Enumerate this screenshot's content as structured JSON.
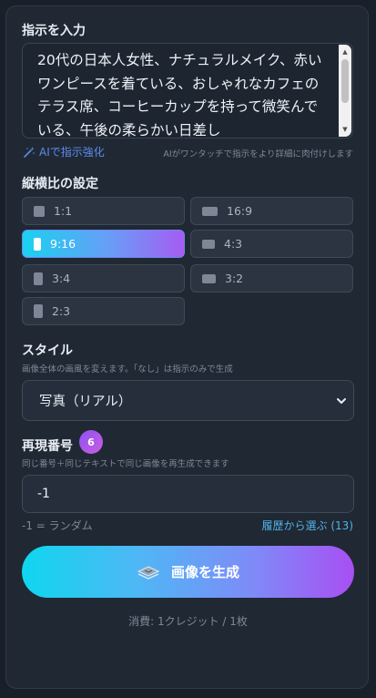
{
  "prompt": {
    "label": "指示を入力",
    "value": "20代の日本人女性、ナチュラルメイク、赤いワンピースを着ている、おしゃれなカフェのテラス席、コーヒーカップを持って微笑んでいる、午後の柔らかい日差し"
  },
  "enhance": {
    "button_label": "AIで指示強化",
    "hint": "AIがワンタッチで指示をより詳細に肉付けします"
  },
  "aspect": {
    "label": "縦横比の設定",
    "selected": "9:16",
    "options": [
      "1:1",
      "16:9",
      "9:16",
      "4:3",
      "3:4",
      "3:2",
      "2:3"
    ]
  },
  "style": {
    "label": "スタイル",
    "description": "画像全体の画風を変えます。「なし」は指示のみで生成",
    "selected": "写真（リアル）"
  },
  "seed": {
    "label": "再現番号",
    "badge": "6",
    "description": "同じ番号＋同じテキストで同じ画像を再生成できます",
    "value": "-1",
    "random_note": "-1 = ランダム",
    "history_link": "履歴から選ぶ (13)"
  },
  "generate": {
    "label": "画像を生成",
    "cost": "消費: 1クレジット / 1枚"
  },
  "colors": {
    "accent_cyan": "#0fd6ef",
    "accent_purple": "#a84ff3",
    "link": "#5b8def",
    "history_link": "#4fb3e8"
  }
}
